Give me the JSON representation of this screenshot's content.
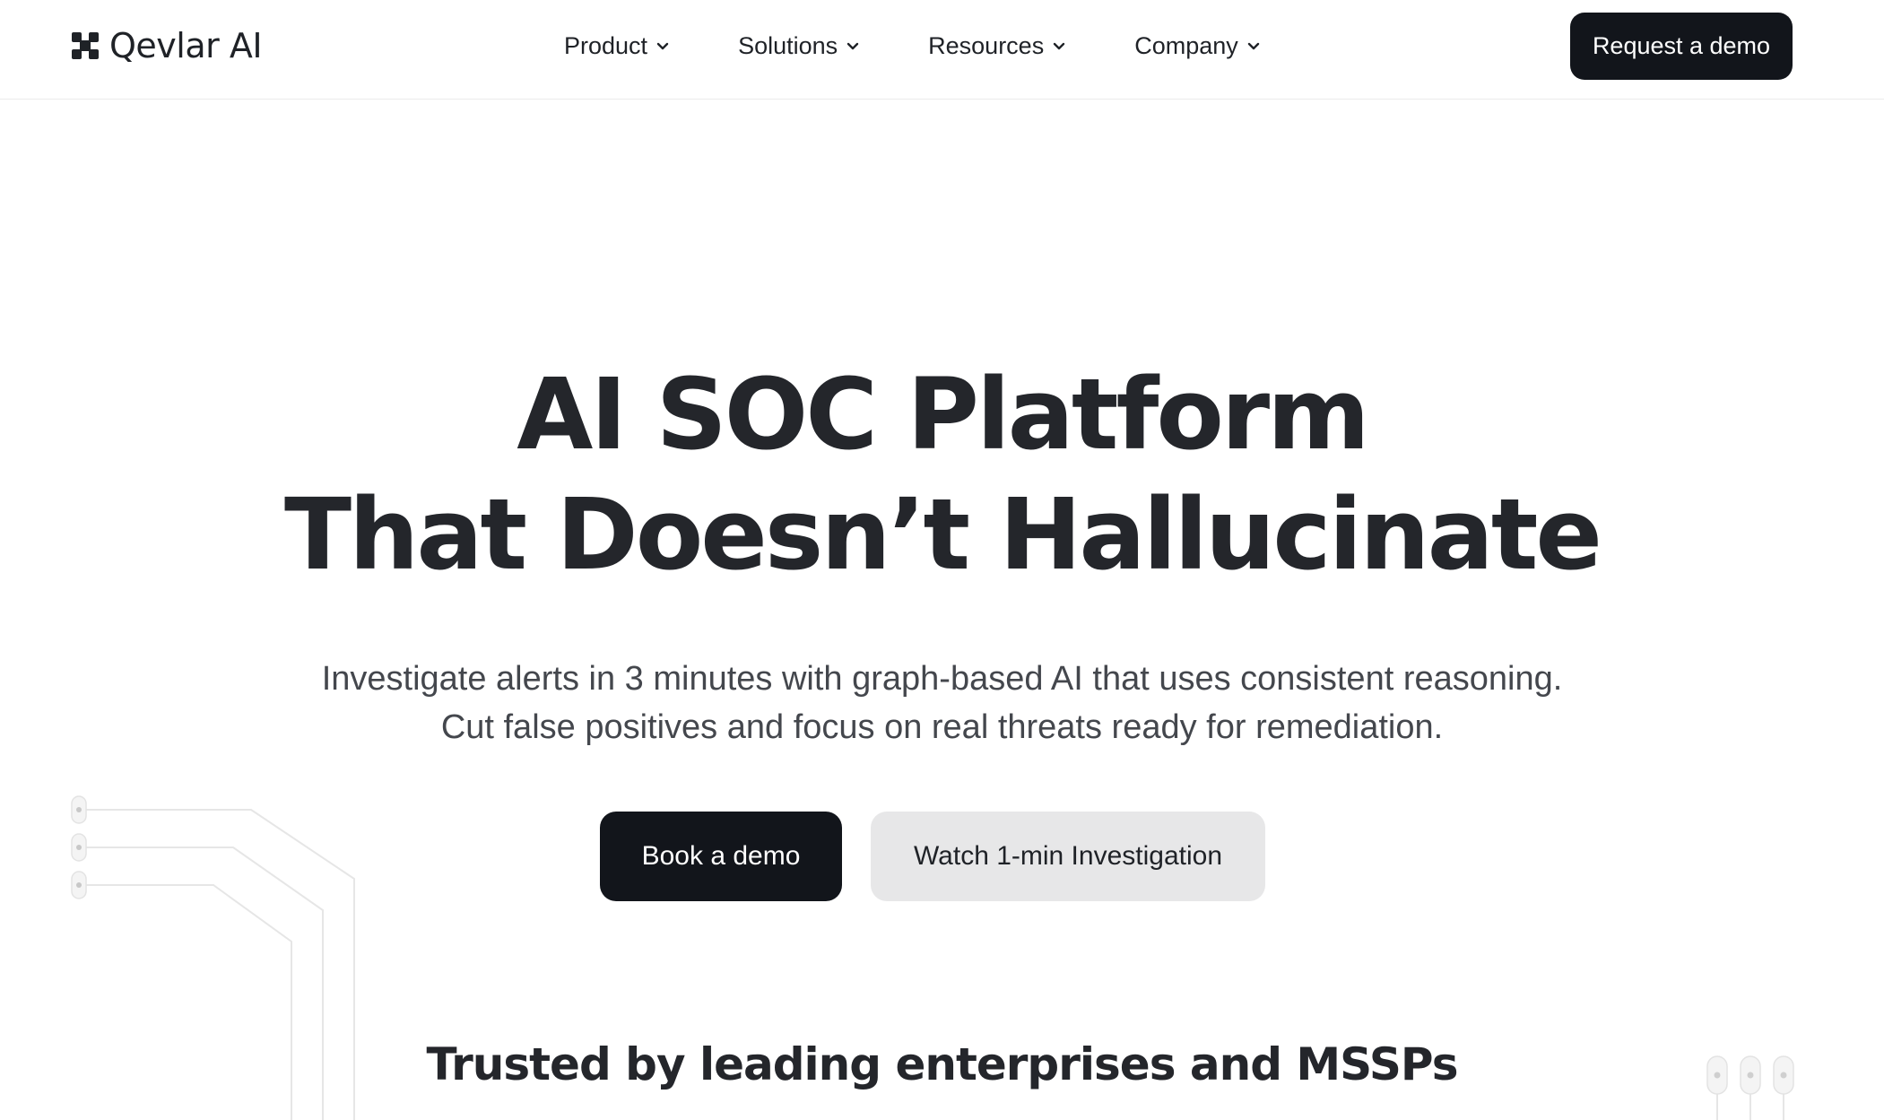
{
  "header": {
    "logo_text": "Qevlar AI",
    "logo_icon": "qevlar-logo-mark",
    "menu": [
      {
        "label": "Product",
        "icon": "chevron-down-icon"
      },
      {
        "label": "Solutions",
        "icon": "chevron-down-icon"
      },
      {
        "label": "Resources",
        "icon": "chevron-down-icon"
      },
      {
        "label": "Company",
        "icon": "chevron-down-icon"
      }
    ],
    "cta_label": "Request a demo"
  },
  "hero": {
    "title_line1": "AI SOC Platform",
    "title_line2": "That Doesn’t Hallucinate",
    "subtitle_line1": "Investigate alerts in 3 minutes with graph-based AI that uses consistent reasoning.",
    "subtitle_line2": "Cut false positives and focus on real threats ready for remediation.",
    "primary_button": "Book a demo",
    "secondary_button": "Watch 1-min Investigation"
  },
  "trusted": {
    "heading": "Trusted by leading enterprises and MSSPs"
  },
  "colors": {
    "dark": "#12151b",
    "text": "#24262b",
    "muted_text": "#44474d",
    "secondary_button_bg": "#e7e7e8",
    "divider": "#ececec",
    "decor_line": "#e6e6e6"
  }
}
